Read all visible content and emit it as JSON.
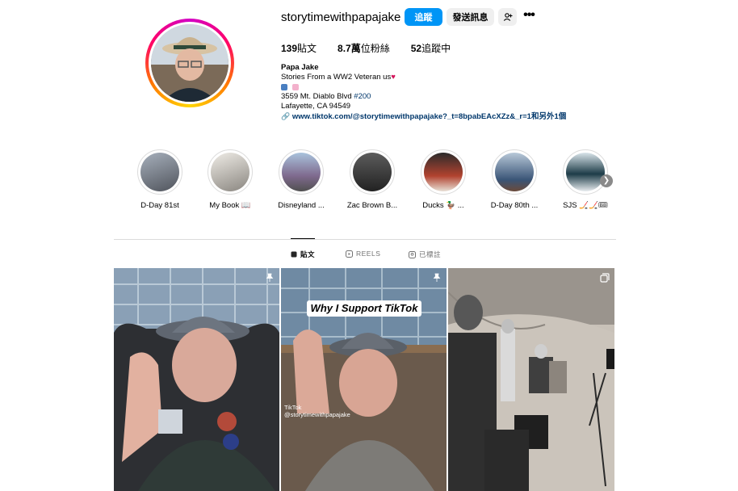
{
  "profile": {
    "username": "storytimewithpapajake",
    "follow_label": "追蹤",
    "message_label": "發送訊息",
    "add_user_icon": "add-user-icon",
    "more_icon": "more-icon",
    "more_glyph": "•••"
  },
  "stats": [
    {
      "value": "139",
      "label": "貼文"
    },
    {
      "value": "8.7萬",
      "label": "位粉絲"
    },
    {
      "value": "52",
      "label": "追蹤中"
    }
  ],
  "bio": {
    "name": "Papa Jake",
    "tagline": "Stories From a WW2 Veteran us",
    "address_line1": "3559 Mt. Diablo Blvd ",
    "address_tag": "#200",
    "address_line2": "Lafayette, CA 94549",
    "link_text": "www.tiktok.com/@storytimewithpapajake?_t=8bpabEAcXZz&_r=1和另外1個"
  },
  "highlights": [
    {
      "label": "D-Day 81st",
      "color": "#8a8f98"
    },
    {
      "label": "My Book 📖",
      "color": "#d9d6cf"
    },
    {
      "label": "Disneyland ...",
      "color": "#7f9db8"
    },
    {
      "label": "Zac Brown B...",
      "color": "#3a3a3a"
    },
    {
      "label": "Ducks 🦆 ...",
      "color": "#9b3b2e"
    },
    {
      "label": "D-Day 80th ...",
      "color": "#6d86a3"
    },
    {
      "label": "SJS 🏒🏒🎟",
      "color": "#2f4f5c"
    }
  ],
  "tabs": [
    {
      "label": "貼文",
      "icon": "grid-icon"
    },
    {
      "label": "REELS",
      "icon": "reels-icon"
    },
    {
      "label": "已標註",
      "icon": "tagged-icon"
    }
  ],
  "posts": [
    {
      "pinned": true,
      "caption": ""
    },
    {
      "pinned": true,
      "caption": "Why I Support TikTok",
      "watermark_brand": "TikTok",
      "watermark_user": "@storytimewithpapajake"
    },
    {
      "pinned": false,
      "caption": ""
    }
  ],
  "colors": {
    "accent": "#0095f6",
    "link": "#00376b",
    "border": "#dbdbdb"
  }
}
